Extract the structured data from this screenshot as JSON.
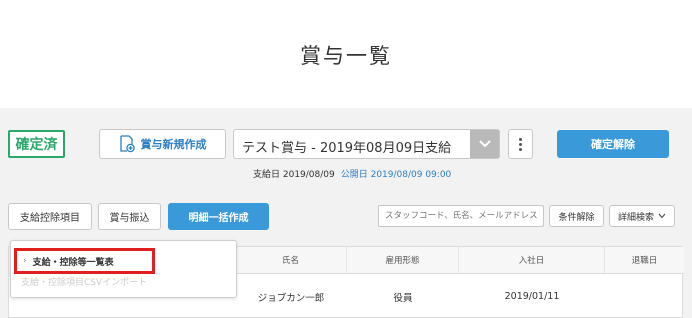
{
  "page": {
    "title": "賞与一覧"
  },
  "header": {
    "status_badge": "確定済",
    "new_button_label": "賞与新規作成",
    "bonus_select_value": "テスト賞与 - 2019年08月09日支給",
    "confirm_cancel_label": "確定解除",
    "pay_date_text": "支給日 2019/08/09",
    "publish_date_text": "公開日 2019/08/09 09:00"
  },
  "toolbar": {
    "items_button_label": "支給控除項目",
    "transfer_button_label": "賞与振込",
    "bulk_create_label": "明細一括作成",
    "search_placeholder": "スタッフコード、氏名、メールアドレス",
    "clear_conditions_label": "条件解除",
    "advanced_search_label": "詳細検索"
  },
  "dropdown": {
    "items": [
      {
        "label": "支給・控除等一覧表"
      },
      {
        "label": "支給・控除項目CSVインポート"
      }
    ]
  },
  "table": {
    "columns": [
      "氏名",
      "雇用形態",
      "入社日",
      "退職日"
    ],
    "rows": [
      {
        "name": "ジョブカン一郎",
        "employment_type": "役員",
        "hire_date": "2019/01/11",
        "retire_date": ""
      }
    ]
  },
  "colors": {
    "accent": "#3a9ad9",
    "status_green": "#2aa86a",
    "highlight_red": "#e0201e",
    "link_blue": "#2b7fc4"
  }
}
